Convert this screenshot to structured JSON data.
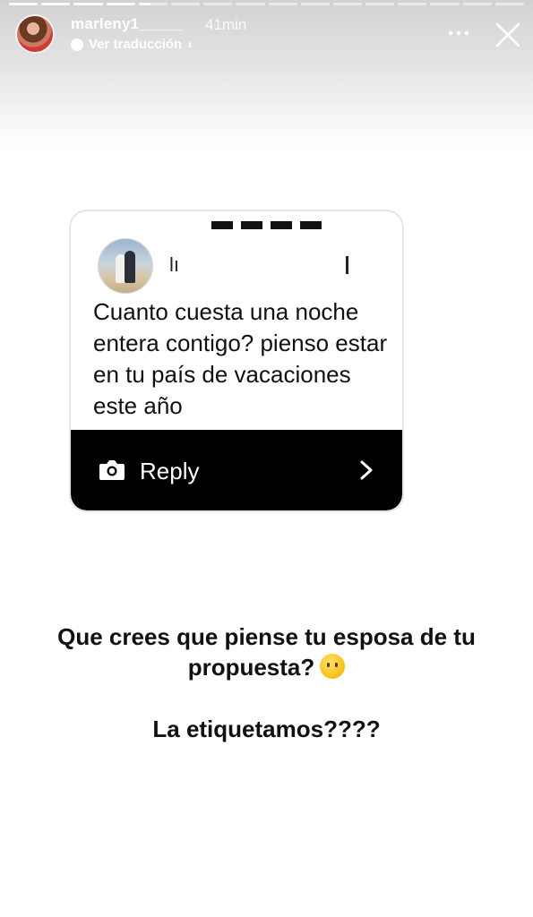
{
  "story": {
    "progress_segments": 16,
    "progress_done": 4,
    "header": {
      "username": "marleny1_____",
      "time": "41min",
      "translate_label": "Ver traducción",
      "translate_chevron": "›"
    },
    "icons": [
      "more-icon",
      "close-icon"
    ]
  },
  "question_card": {
    "user_visible": "lı",
    "message": "Cuanto cuesta una noche entera contigo? pienso estar en tu país de vacaciones este año",
    "reply_label": "Reply",
    "icons": [
      "camera-icon",
      "chevron-right-icon"
    ]
  },
  "captions": {
    "line1": "Que crees que piense tu esposa de tu propuesta?",
    "emoji": "🤔",
    "line2": "La etiquetamos????"
  },
  "colors": {
    "header_gradient": "#d2d2d2",
    "reply_bar": "#000000",
    "text": "#111111"
  }
}
